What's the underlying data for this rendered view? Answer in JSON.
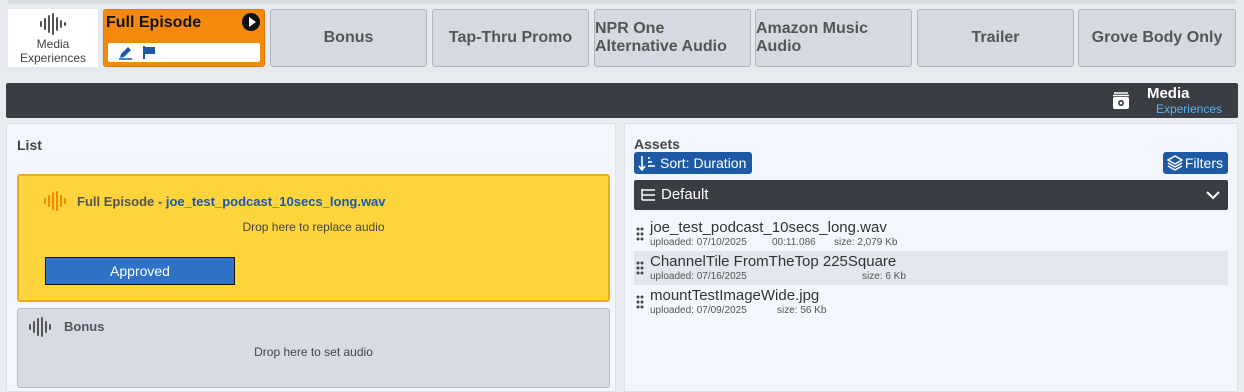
{
  "brand": {
    "line1": "Media",
    "line2": "Experiences",
    "icon": "waveform-icon"
  },
  "tabs": [
    {
      "label": "Full Episode",
      "active": true
    },
    {
      "label": "Bonus"
    },
    {
      "label": "Tap-Thru Promo"
    },
    {
      "label": "NPR One Alternative Audio"
    },
    {
      "label": "Amazon Music Audio"
    },
    {
      "label": "Trailer"
    },
    {
      "label": "Grove Body Only"
    }
  ],
  "header": {
    "title": "Media",
    "subtitle": "Experiences",
    "icon": "media-experiences-icon"
  },
  "list": {
    "heading": "List",
    "slots": [
      {
        "type_label": "Full Episode",
        "separator": " - ",
        "file": "joe_test_podcast_10secs_long.wav",
        "hint": "Drop here to replace audio",
        "status": "Approved"
      },
      {
        "type_label": "Bonus",
        "hint": "Drop here to set audio"
      }
    ]
  },
  "assets": {
    "heading": "Assets",
    "sort_label": "Sort: Duration",
    "filters_label": "Filters",
    "view_label": "Default",
    "items": [
      {
        "name": "joe_test_podcast_10secs_long.wav",
        "uploaded": "uploaded: 07/10/2025",
        "duration": "00:11.086",
        "size": "size: 2,079 Kb"
      },
      {
        "name": "ChannelTile FromTheTop 225Square",
        "uploaded": "uploaded: 07/16/2025",
        "duration": "",
        "size": "size: 6 Kb"
      },
      {
        "name": "mountTestImageWide.jpg",
        "uploaded": "uploaded: 07/09/2025",
        "duration": "",
        "size": "size: 56 Kb"
      }
    ]
  },
  "colors": {
    "accent_orange": "#f48a0b",
    "approved_blue": "#2e73c6",
    "dark_bar": "#3b3d44",
    "drop_yellow": "#fdd43b"
  }
}
